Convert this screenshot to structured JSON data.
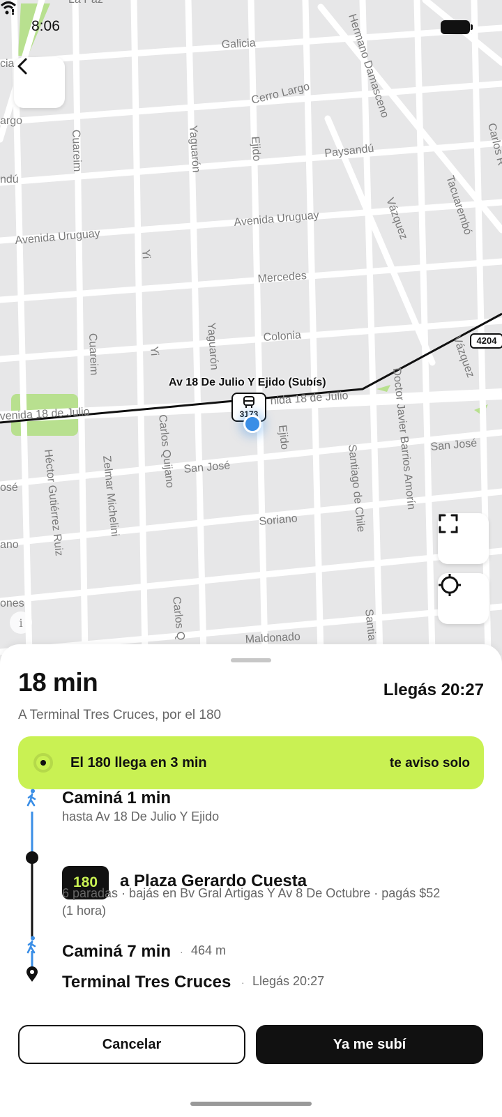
{
  "status_bar": {
    "time": "8:06"
  },
  "map": {
    "street_labels": {
      "galicia": "Galicia",
      "cerro_largo": "Cerro Largo",
      "hermano": "Hermano Damasceno",
      "paysandu": "Paysandú",
      "cuareim_1": "Cuareim",
      "yaguaron_1": "Yaguarón",
      "ejido_1": "Ejido",
      "avuruguay_1": "Avenida Uruguay",
      "avuruguay_2": "Avenida Uruguay",
      "vazquez_1": "Vázquez",
      "tacuarembo": "Tacuarembó",
      "carlos": "Carlos R",
      "yi_1": "Yi",
      "mercedes": "Mercedes",
      "colonia": "Colonia",
      "cuareim_2": "Cuareim",
      "yi_2": "Yi",
      "yaguaron_2": "Yaguarón",
      "vazquez_2": "Vázquez",
      "avenida18_left": "venida 18 de Julio",
      "avenida18_right": "nida 18 de Julio",
      "doctor": "Doctor Javier Barrios Amorín",
      "carlos_quijano_1": "Carlos Quijano",
      "ejido_2": "Ejido",
      "santiago_1": "Santiago de Chile",
      "sanjose_1": "San José",
      "sanjose_2": "San José",
      "sanjose_left": "osé",
      "hector": "Héctor Gutiérrez Ruiz",
      "zelmar": "Zelmar Michelini",
      "soriano": "Soriano",
      "soriano_left": "ano",
      "ones_left": "ones",
      "carlos_q_2": "Carlos Q",
      "santia": "Santia",
      "maldonado": "Maldonado",
      "largo_left": "argo",
      "ndu_left": "ndú",
      "cia_left": "cia",
      "lapaz": "La Paz"
    },
    "stop_label": "Av 18 De Julio Y Ejido (Subís)",
    "stop_number": "3173",
    "route_shield": "4204",
    "info_label": "i"
  },
  "sheet": {
    "duration": "18 min",
    "destination": "A Terminal Tres Cruces, por el 180",
    "arrival": "Llegás 20:27",
    "alert": {
      "message": "El 180 llega en 3 min",
      "option": "te aviso solo"
    },
    "steps": {
      "walk1_title": "Caminá 1 min",
      "walk1_sub": "hasta Av 18 De Julio Y Ejido",
      "bus_route": "180",
      "bus_title": "a Plaza Gerardo Cuesta",
      "bus_detail_1": "6 paradas · bajás en Bv Gral Artigas Y Av 8 De Octubre · pagás $52",
      "bus_detail_2": "(1 hora)",
      "walk2_title": "Caminá 7 min",
      "walk2_sep": "·",
      "walk2_dist": "464 m",
      "final_title": "Terminal Tres Cruces",
      "final_sep": "·",
      "final_arrival": "Llegás 20:27"
    },
    "buttons": {
      "cancel": "Cancelar",
      "confirm": "Ya me subí"
    }
  },
  "colors": {
    "accent": "#c9f153",
    "walk_line": "#3a8ee6",
    "dark": "#111111"
  }
}
